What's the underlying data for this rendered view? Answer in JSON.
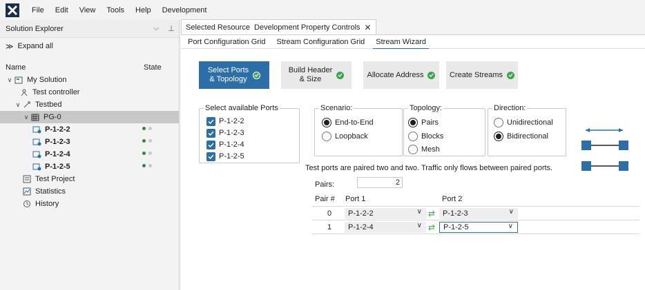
{
  "menu": [
    "File",
    "Edit",
    "View",
    "Tools",
    "Help",
    "Development"
  ],
  "solution_explorer": {
    "title": "Solution Explorer",
    "pin_glyph": "⊥",
    "expand_all": "Expand all",
    "col_name": "Name",
    "col_state": "State",
    "tree": {
      "solution": "My Solution",
      "controller": "Test controller",
      "testbed": "Testbed",
      "pg": "PG-0",
      "ports": [
        "P-1-2-2",
        "P-1-2-3",
        "P-1-2-4",
        "P-1-2-5"
      ],
      "project": "Test Project",
      "statistics": "Statistics",
      "history": "History"
    }
  },
  "doc_tab": {
    "label": "Selected Resource  Development Property Controls"
  },
  "sub_tabs": [
    "Port Configuration Grid",
    "Stream Configuration Grid",
    "Stream Wizard"
  ],
  "steps": [
    "Select Ports\n& Topology",
    "Build Header\n& Size",
    "Allocate Address",
    "Create Streams"
  ],
  "ports_group": {
    "title": "Select available Ports",
    "ports": [
      "P-1-2-2",
      "P-1-2-3",
      "P-1-2-4",
      "P-1-2-5"
    ]
  },
  "scenario": {
    "title": "Scenario:",
    "options": [
      "End-to-End",
      "Loopback"
    ],
    "selected": "End-to-End"
  },
  "topology": {
    "title": "Topology:",
    "options": [
      "Pairs",
      "Blocks",
      "Mesh"
    ],
    "selected": "Pairs"
  },
  "direction": {
    "title": "Direction:",
    "options": [
      "Unidirectional",
      "Bidirectional"
    ],
    "selected": "Bidirectional"
  },
  "info_text": "Test ports are paired two and two. Traffic only flows between paired ports.",
  "pairs": {
    "label": "Pairs:",
    "value": "2"
  },
  "table": {
    "headers": [
      "Pair #",
      "Port 1",
      "Port 2"
    ],
    "rows": [
      {
        "idx": "0",
        "port1": "P-1-2-2",
        "port2": "P-1-2-3"
      },
      {
        "idx": "1",
        "port1": "P-1-2-4",
        "port2": "P-1-2-5"
      }
    ]
  },
  "colors": {
    "accent": "#2c6fa8",
    "ok": "#3aa74a",
    "state_on": "#2e8b3a"
  }
}
